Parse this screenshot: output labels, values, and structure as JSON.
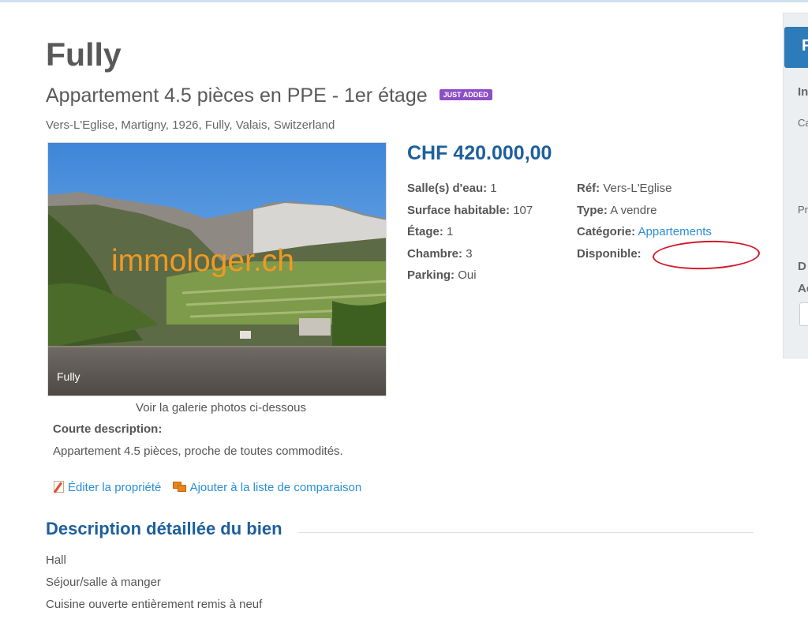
{
  "property": {
    "title": "Fully",
    "subtitle": "Appartement 4.5 pièces en PPE - 1er étage",
    "badge": "JUST ADDED",
    "address": "Vers-L'Eglise, Martigny, 1926, Fully, Valais, Switzerland",
    "price": "CHF 420.000,00"
  },
  "photo": {
    "watermark": "immologer.ch",
    "caption": "Fully",
    "gallery_note": "Voir la galerie photos ci-dessous"
  },
  "specs_left": [
    {
      "label": "Salle(s) d'eau:",
      "value": "1"
    },
    {
      "label": "Surface habitable:",
      "value": "107"
    },
    {
      "label": "Étage:",
      "value": "1"
    },
    {
      "label": "Chambre:",
      "value": "3"
    },
    {
      "label": "Parking:",
      "value": "Oui"
    }
  ],
  "specs_right": [
    {
      "label": "Réf:",
      "value": "Vers-L'Eglise"
    },
    {
      "label": "Type:",
      "value": "A vendre"
    },
    {
      "label": "Catégorie:",
      "value": "Appartements"
    },
    {
      "label": "Disponible:",
      "value": ""
    }
  ],
  "short_description": {
    "label": "Courte description:",
    "text": "Appartement 4.5 pièces, proche de toutes commodités."
  },
  "actions": {
    "edit": "Éditer la propriété",
    "compare": "Ajouter à la liste de comparaison"
  },
  "detailed": {
    "title": "Description détaillée du bien",
    "lines": [
      "Hall",
      "Séjour/salle à manger",
      "Cuisine ouverte entièrement remis à neuf"
    ]
  },
  "sidebar": {
    "button_letter": "F",
    "fragments": [
      "In",
      "Ca",
      "Pr",
      "D",
      "Ac"
    ]
  },
  "colors": {
    "heading_blue": "#1d5f9c",
    "link_blue": "#2b8fd8",
    "badge_purple": "#8e4ec6",
    "annotation_red": "#d3182a"
  }
}
